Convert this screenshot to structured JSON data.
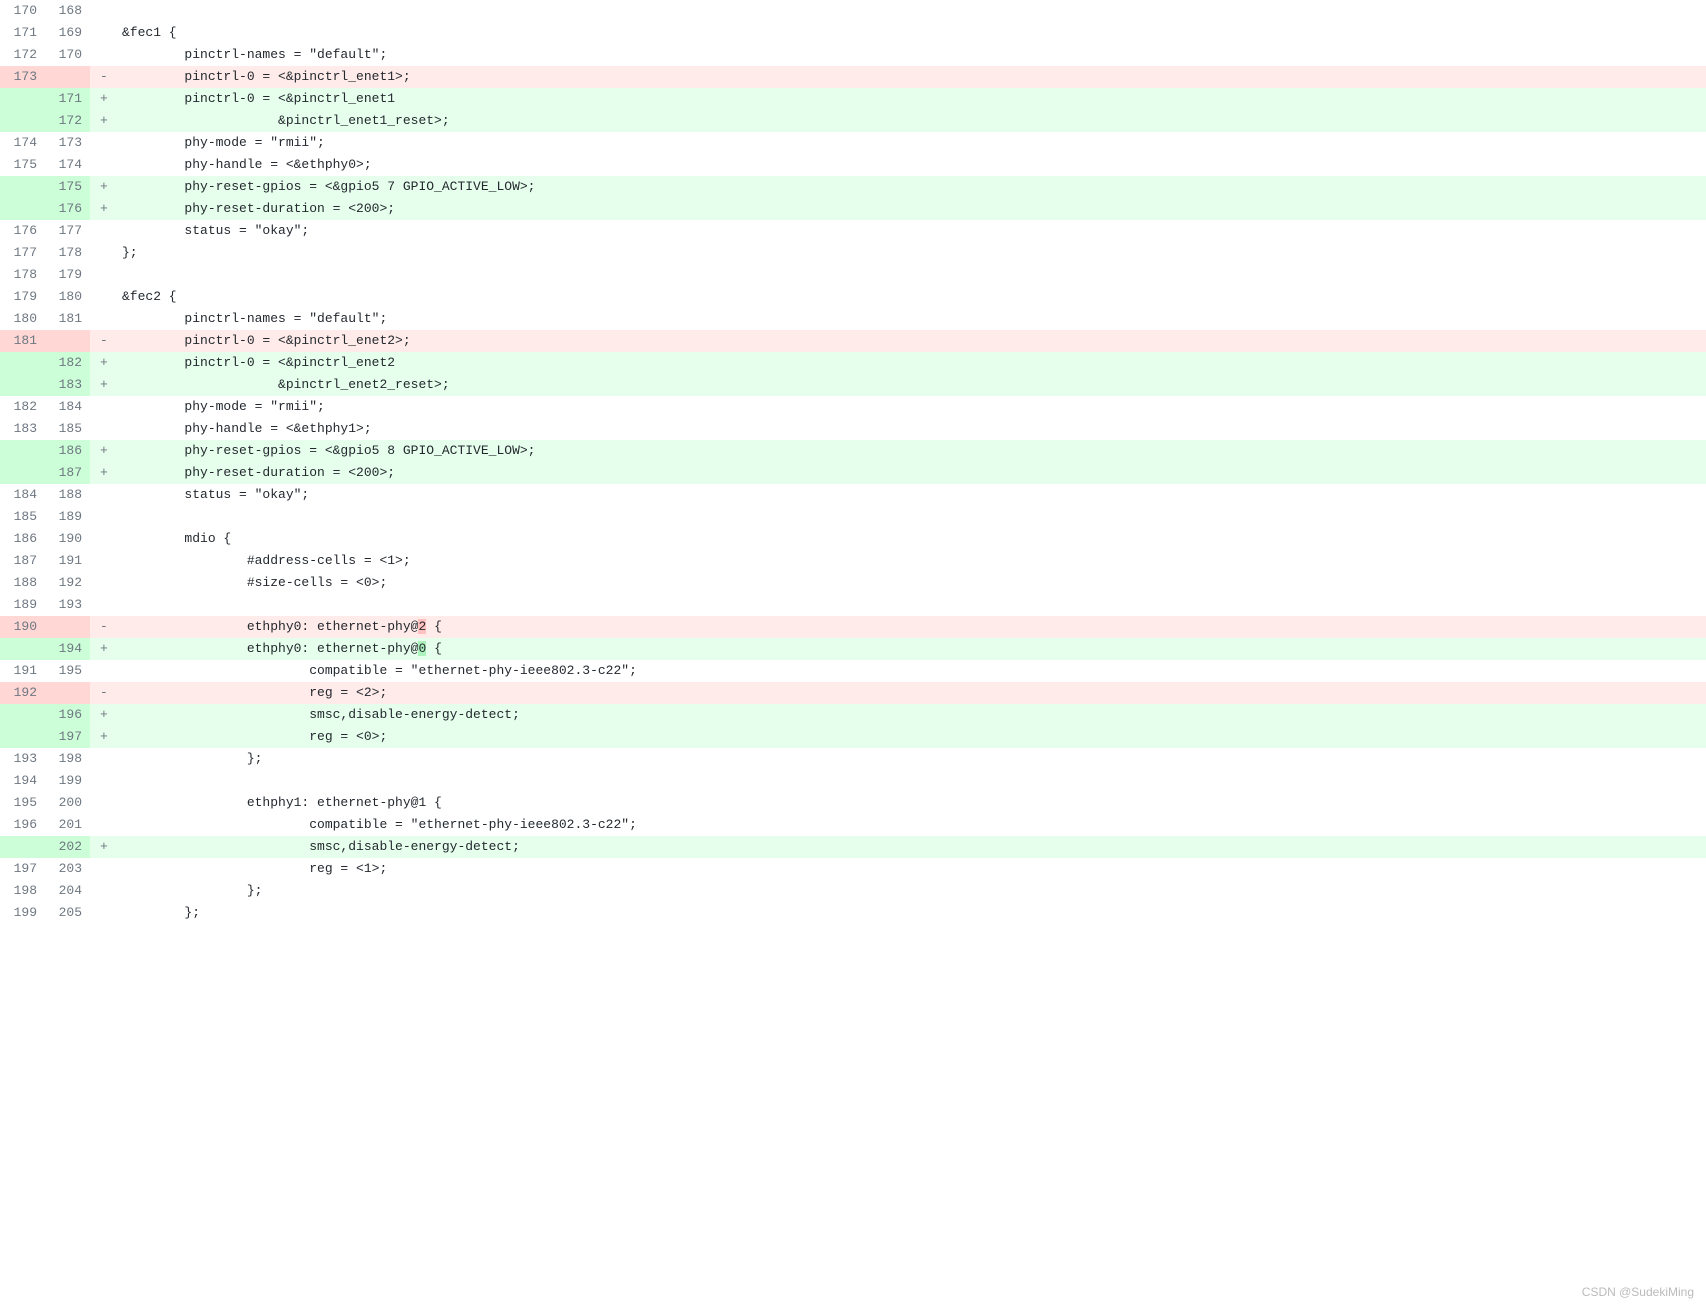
{
  "watermark": "CSDN @SudekiMing",
  "rows": [
    {
      "old": "170",
      "new": "168",
      "type": "ctx",
      "marker": "",
      "code": ""
    },
    {
      "old": "171",
      "new": "169",
      "type": "ctx",
      "marker": "",
      "code": "&fec1 {"
    },
    {
      "old": "172",
      "new": "170",
      "type": "ctx",
      "marker": "",
      "code": "        pinctrl-names = \"default\";"
    },
    {
      "old": "173",
      "new": "",
      "type": "del",
      "marker": "-",
      "code": "        pinctrl-0 = <&pinctrl_enet1>;"
    },
    {
      "old": "",
      "new": "171",
      "type": "add",
      "marker": "+",
      "code": "        pinctrl-0 = <&pinctrl_enet1"
    },
    {
      "old": "",
      "new": "172",
      "type": "add",
      "marker": "+",
      "code": "                    &pinctrl_enet1_reset>;"
    },
    {
      "old": "174",
      "new": "173",
      "type": "ctx",
      "marker": "",
      "code": "        phy-mode = \"rmii\";"
    },
    {
      "old": "175",
      "new": "174",
      "type": "ctx",
      "marker": "",
      "code": "        phy-handle = <&ethphy0>;"
    },
    {
      "old": "",
      "new": "175",
      "type": "add",
      "marker": "+",
      "code": "        phy-reset-gpios = <&gpio5 7 GPIO_ACTIVE_LOW>;"
    },
    {
      "old": "",
      "new": "176",
      "type": "add",
      "marker": "+",
      "code": "        phy-reset-duration = <200>;"
    },
    {
      "old": "176",
      "new": "177",
      "type": "ctx",
      "marker": "",
      "code": "        status = \"okay\";"
    },
    {
      "old": "177",
      "new": "178",
      "type": "ctx",
      "marker": "",
      "code": "};"
    },
    {
      "old": "178",
      "new": "179",
      "type": "ctx",
      "marker": "",
      "code": ""
    },
    {
      "old": "179",
      "new": "180",
      "type": "ctx",
      "marker": "",
      "code": "&fec2 {"
    },
    {
      "old": "180",
      "new": "181",
      "type": "ctx",
      "marker": "",
      "code": "        pinctrl-names = \"default\";"
    },
    {
      "old": "181",
      "new": "",
      "type": "del",
      "marker": "-",
      "code": "        pinctrl-0 = <&pinctrl_enet2>;"
    },
    {
      "old": "",
      "new": "182",
      "type": "add",
      "marker": "+",
      "code": "        pinctrl-0 = <&pinctrl_enet2"
    },
    {
      "old": "",
      "new": "183",
      "type": "add",
      "marker": "+",
      "code": "                    &pinctrl_enet2_reset>;"
    },
    {
      "old": "182",
      "new": "184",
      "type": "ctx",
      "marker": "",
      "code": "        phy-mode = \"rmii\";"
    },
    {
      "old": "183",
      "new": "185",
      "type": "ctx",
      "marker": "",
      "code": "        phy-handle = <&ethphy1>;"
    },
    {
      "old": "",
      "new": "186",
      "type": "add",
      "marker": "+",
      "code": "        phy-reset-gpios = <&gpio5 8 GPIO_ACTIVE_LOW>;"
    },
    {
      "old": "",
      "new": "187",
      "type": "add",
      "marker": "+",
      "code": "        phy-reset-duration = <200>;"
    },
    {
      "old": "184",
      "new": "188",
      "type": "ctx",
      "marker": "",
      "code": "        status = \"okay\";"
    },
    {
      "old": "185",
      "new": "189",
      "type": "ctx",
      "marker": "",
      "code": ""
    },
    {
      "old": "186",
      "new": "190",
      "type": "ctx",
      "marker": "",
      "code": "        mdio {"
    },
    {
      "old": "187",
      "new": "191",
      "type": "ctx",
      "marker": "",
      "code": "                #address-cells = <1>;"
    },
    {
      "old": "188",
      "new": "192",
      "type": "ctx",
      "marker": "",
      "code": "                #size-cells = <0>;"
    },
    {
      "old": "189",
      "new": "193",
      "type": "ctx",
      "marker": "",
      "code": ""
    },
    {
      "old": "190",
      "new": "",
      "type": "del",
      "marker": "-",
      "code_parts": [
        "                ethphy0: ethernet-phy@",
        "2",
        " {"
      ],
      "hl": [
        false,
        true,
        false
      ]
    },
    {
      "old": "",
      "new": "194",
      "type": "add",
      "marker": "+",
      "code_parts": [
        "                ethphy0: ethernet-phy@",
        "0",
        " {"
      ],
      "hl": [
        false,
        true,
        false
      ]
    },
    {
      "old": "191",
      "new": "195",
      "type": "ctx",
      "marker": "",
      "code": "                        compatible = \"ethernet-phy-ieee802.3-c22\";"
    },
    {
      "old": "192",
      "new": "",
      "type": "del",
      "marker": "-",
      "code": "                        reg = <2>;"
    },
    {
      "old": "",
      "new": "196",
      "type": "add",
      "marker": "+",
      "code": "                        smsc,disable-energy-detect;"
    },
    {
      "old": "",
      "new": "197",
      "type": "add",
      "marker": "+",
      "code": "                        reg = <0>;"
    },
    {
      "old": "193",
      "new": "198",
      "type": "ctx",
      "marker": "",
      "code": "                };"
    },
    {
      "old": "194",
      "new": "199",
      "type": "ctx",
      "marker": "",
      "code": ""
    },
    {
      "old": "195",
      "new": "200",
      "type": "ctx",
      "marker": "",
      "code": "                ethphy1: ethernet-phy@1 {"
    },
    {
      "old": "196",
      "new": "201",
      "type": "ctx",
      "marker": "",
      "code": "                        compatible = \"ethernet-phy-ieee802.3-c22\";"
    },
    {
      "old": "",
      "new": "202",
      "type": "add",
      "marker": "+",
      "code": "                        smsc,disable-energy-detect;"
    },
    {
      "old": "197",
      "new": "203",
      "type": "ctx",
      "marker": "",
      "code": "                        reg = <1>;"
    },
    {
      "old": "198",
      "new": "204",
      "type": "ctx",
      "marker": "",
      "code": "                };"
    },
    {
      "old": "199",
      "new": "205",
      "type": "ctx",
      "marker": "",
      "code": "        };"
    }
  ]
}
